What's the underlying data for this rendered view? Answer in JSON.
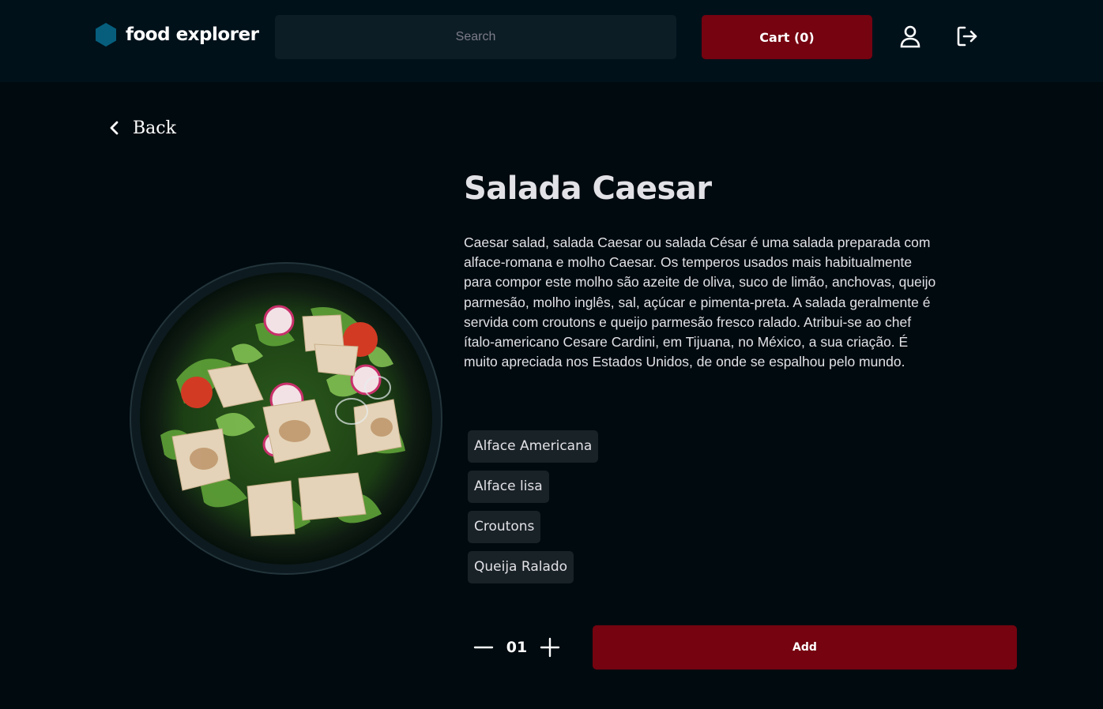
{
  "header": {
    "brand_name": "food explorer",
    "search_placeholder": "Search",
    "cart_label": "Cart (0)"
  },
  "nav": {
    "back_label": "Back"
  },
  "dish": {
    "title": "Salada Caesar",
    "description": "Caesar salad, salada Caesar ou salada César é uma salada preparada com alface-romana e molho Caesar. Os temperos usados mais habitualmente para compor este molho são azeite de oliva, suco de limão, anchovas, queijo parmesão, molho inglês, sal, açúcar e pimenta-preta. A salada geralmente é servida com croutons e queijo parmesão fresco ralado. Atribui-se ao chef ítalo-americano Cesare Cardini, em Tijuana, no México, a sua criação. É muito apreciada nos Estados Unidos, de onde se espalhou pelo mundo.",
    "ingredients": [
      "Alface Americana",
      "Alface lisa",
      "Croutons",
      "Queija Ralado"
    ],
    "quantity": "01",
    "add_label": "Add"
  },
  "icons": {
    "logo": "hexagon-logo-icon",
    "profile": "user-icon",
    "logout": "sign-out-icon",
    "back": "chevron-left-icon",
    "decrease": "minus-icon",
    "increase": "plus-icon"
  },
  "colors": {
    "background": "#000a0f",
    "header": "#00111a",
    "accent": "#750310",
    "logo": "#065e7c",
    "tag": "#192227"
  }
}
